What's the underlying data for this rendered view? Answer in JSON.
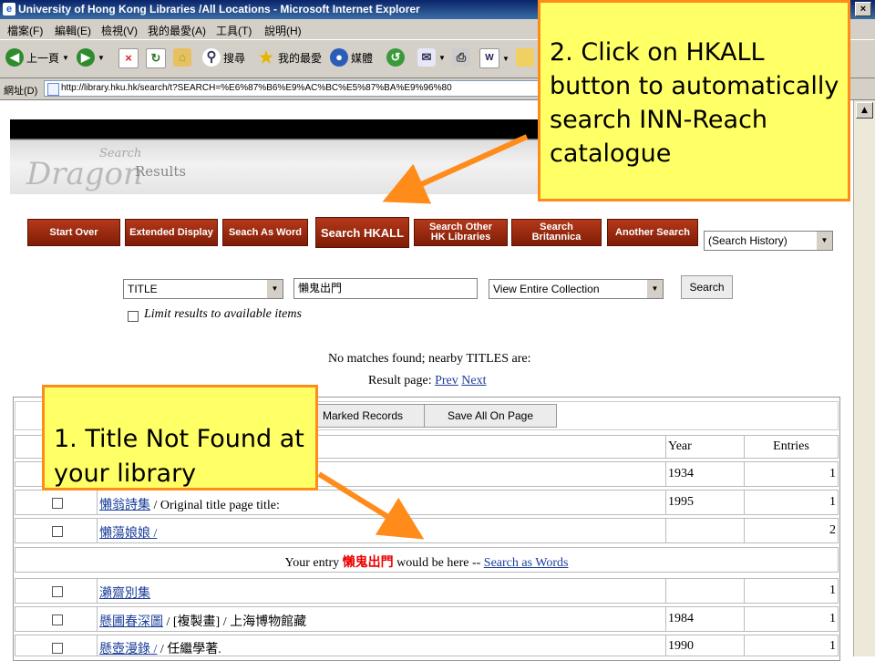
{
  "window": {
    "title": "University of Hong Kong Libraries /All Locations - Microsoft Internet Explorer"
  },
  "menu": [
    "檔案(F)",
    "編輯(E)",
    "檢視(V)",
    "我的最愛(A)",
    "工具(T)",
    "說明(H)"
  ],
  "toolbar": {
    "back": "上一頁",
    "search": "搜尋",
    "favorites": "我的最愛",
    "media": "媒體"
  },
  "address": {
    "label": "網址(D)",
    "url": "http://library.hku.hk/search/t?SEARCH=%E6%87%B6%E9%AC%BC%E5%87%BA%E9%96%80"
  },
  "banner": {
    "brand": "Dragon",
    "word_search": "Search",
    "word_results": "Results"
  },
  "nav_buttons": [
    "Start Over",
    "Extended Display",
    "Seach As Word",
    "Search HKALL",
    "Search Other\nHK Libraries",
    "Search\nBritannica",
    "Another Search"
  ],
  "history_select": "(Search History)",
  "search_form": {
    "field_select": "TITLE",
    "query": "懶鬼出門",
    "scope_select": "View Entire Collection",
    "search_button": "Search",
    "limit_label": "Limit results to available items"
  },
  "results_msg": {
    "no_match": "No matches found; nearby TITLES are:",
    "page_label": "Result page:",
    "prev": "Prev",
    "next": "Next"
  },
  "table": {
    "marked_button": "Marked Records",
    "save_button": "Save All On Page",
    "col_year": "Year",
    "col_entries": "Entries",
    "rows": [
      {
        "title": "",
        "rest": "",
        "year": "1934",
        "entries": "1"
      },
      {
        "title": "懶翁詩集",
        "rest": " / Original title page title:",
        "year": "1995",
        "entries": "1"
      },
      {
        "title": "懶蕩娘娘 /",
        "rest": "",
        "year": "",
        "entries": "2"
      }
    ],
    "entry_line": {
      "prefix": "Your entry",
      "term": "懶鬼出門",
      "middle": "would be here --",
      "link": "Search as Words"
    },
    "rows2": [
      {
        "title": "瀨齋別集",
        "rest": "",
        "year": "",
        "entries": "1"
      },
      {
        "title": "懸圃春深圖",
        "rest": " / [複製畫] / 上海博物館藏",
        "year": "1984",
        "entries": "1"
      },
      {
        "title": "懸壺漫錄 /",
        "rest": " / 任繼學著.",
        "year": "1990",
        "entries": "1"
      }
    ]
  },
  "callouts": {
    "hkall": "2. Click on HKALL button to automatically search INN-Reach catalogue",
    "notfound": "1. Title Not Found at your library"
  },
  "colors": {
    "accent_orange": "#ff8c1a",
    "callout_yellow": "#ffff66",
    "button_red": "#9a2a0e",
    "link_blue": "#1a3d9a"
  }
}
